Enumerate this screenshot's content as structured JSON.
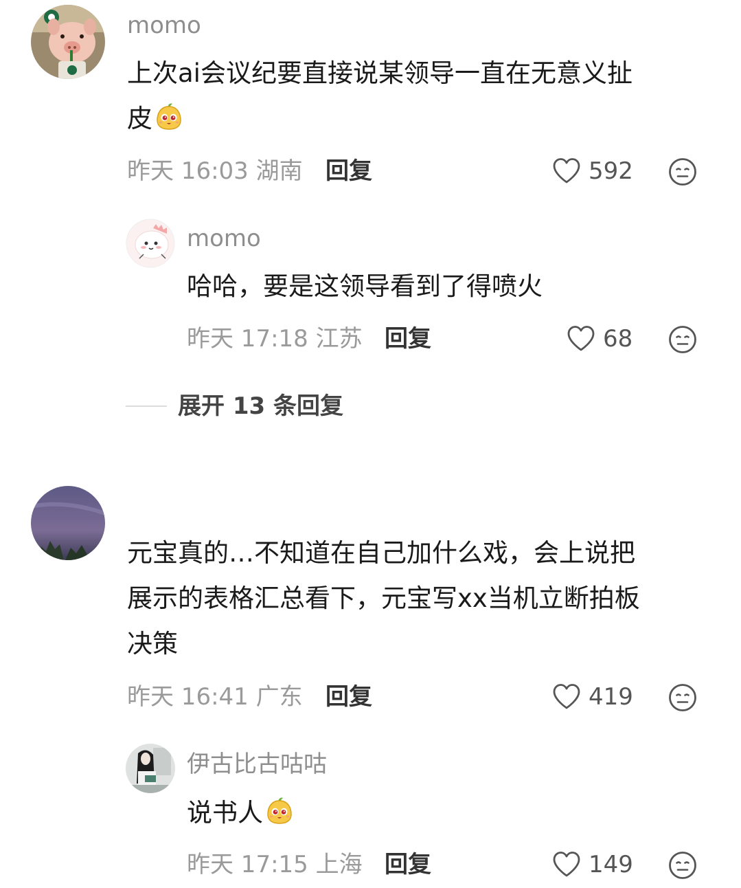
{
  "comments": [
    {
      "username": "momo",
      "text_lines": [
        "上次ai会议纪要直接说某领导一直在无意义扯",
        "皮"
      ],
      "emoji_icon": "yuanbao-emoji-icon",
      "time": "昨天 16:03",
      "location": "湖南",
      "reply_label": "回复",
      "likes": "592",
      "replies": [
        {
          "username": "momo",
          "text": "哈哈，要是这领导看到了得喷火",
          "time": "昨天 17:18",
          "location": "江苏",
          "reply_label": "回复",
          "likes": "68"
        }
      ],
      "expand_label": "展开 13 条回复"
    },
    {
      "username": "",
      "text_lines": [
        "元宝真的…不知道在自己加什么戏，会上说把",
        "展示的表格汇总看下，元宝写xx当机立断拍板",
        "决策"
      ],
      "time": "昨天 16:41",
      "location": "广东",
      "reply_label": "回复",
      "likes": "419",
      "replies": [
        {
          "username": "伊古比古咕咕",
          "text": "说书人",
          "emoji_icon": "yuanbao-emoji-icon",
          "time": "昨天 17:15",
          "location": "上海",
          "reply_label": "回复",
          "likes": "149"
        }
      ]
    }
  ],
  "icons": {
    "like": "heart-outline-icon",
    "dislike": "neutral-face-icon"
  },
  "colors": {
    "text_primary": "#1a1a1a",
    "text_meta": "#9a9a9a",
    "username": "#8e8e8e"
  }
}
